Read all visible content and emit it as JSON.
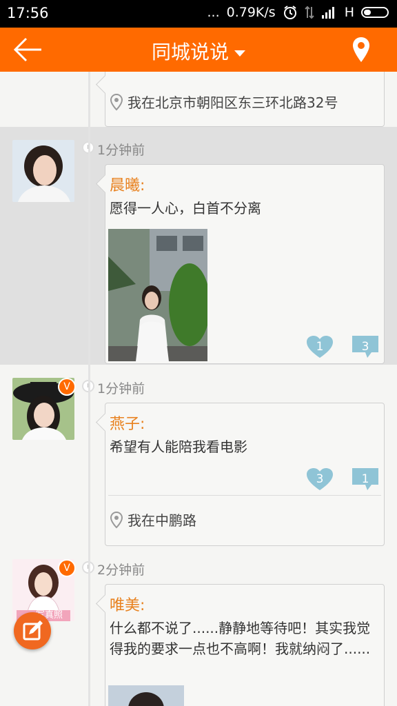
{
  "status_bar": {
    "time": "17:56",
    "dots": "...",
    "speed": "0.79K/s",
    "network": "H"
  },
  "header": {
    "title": "同城说说"
  },
  "feed": {
    "top_location": "我在北京市朝阳区东三环北路32号",
    "posts": [
      {
        "time_ago": "1分钟前",
        "author": "晨曦:",
        "text": "愿得一人心，白首不分离",
        "likes": "1",
        "comments": "3"
      },
      {
        "time_ago": "1分钟前",
        "author": "燕子:",
        "text": "希望有人能陪我看电影",
        "likes": "3",
        "comments": "1",
        "location": "我在中鹏路",
        "badge": "V"
      },
      {
        "time_ago": "2分钟前",
        "author": "唯美:",
        "text": "什么都不说了......静静地等待吧！其实我觉得我的要求一点也不高啊！我就纳闷了......",
        "badge": "V",
        "avatar_caption": "写真照"
      }
    ]
  },
  "colors": {
    "accent": "#ff6a00",
    "name": "#e8811e",
    "count_icon": "#8fc4d6"
  }
}
